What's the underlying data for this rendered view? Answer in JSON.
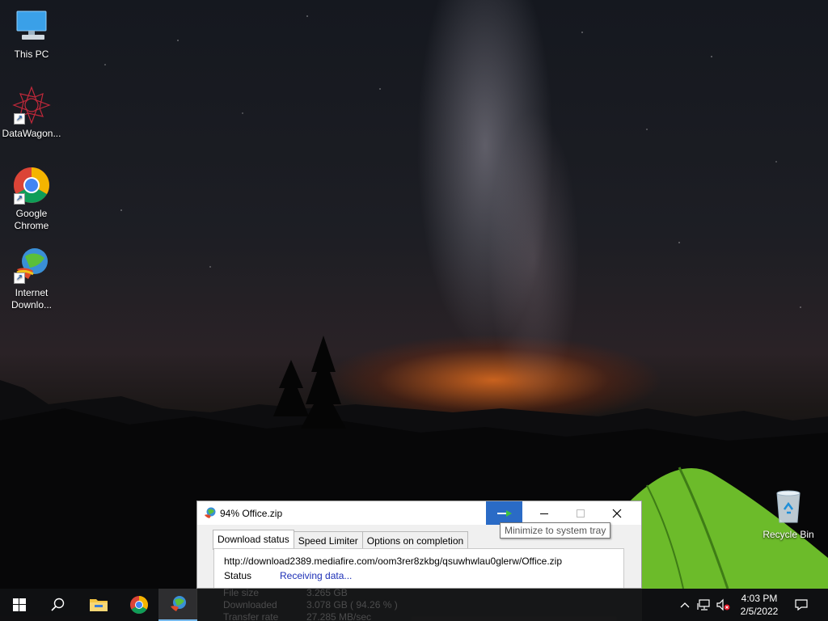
{
  "desktop": {
    "icons": [
      {
        "label": "This PC",
        "icon": "this-pc-icon"
      },
      {
        "label": "DataWagon...",
        "icon": "datawagon-icon"
      },
      {
        "label": "Google Chrome",
        "icon": "chrome-icon"
      },
      {
        "label": "Internet Downlo...",
        "icon": "idm-icon"
      },
      {
        "label": "Recycle Bin",
        "icon": "recycle-bin-icon"
      }
    ]
  },
  "download_window": {
    "title": "94% Office.zip",
    "tabs": [
      "Download status",
      "Speed Limiter",
      "Options on completion"
    ],
    "active_tab": 0,
    "url": "http://download2389.mediafire.com/oom3rer8zkbg/qsuwhwlau0glerw/Office.zip",
    "status_label": "Status",
    "status_value": "Receiving data...",
    "file_size_label": "File size",
    "file_size_value": "3.265  GB",
    "downloaded_label": "Downloaded",
    "downloaded_value": "3.078  GB  ( 94.26 % )",
    "transfer_rate_label": "Transfer rate",
    "transfer_rate_value": "27.285  MB/sec",
    "progress_percent": 94.26
  },
  "tooltip": {
    "text": "Minimize to system tray"
  },
  "taskbar": {
    "items": [
      "start-icon",
      "search-icon",
      "file-explorer-icon",
      "chrome-icon",
      "idm-icon"
    ],
    "active_item": "idm-icon",
    "tray_icons": [
      "chevron-up-icon",
      "network-icon",
      "volume-muted-icon"
    ],
    "time": "4:03 PM",
    "date": "2/5/2022",
    "accent": "#76b9ed"
  }
}
